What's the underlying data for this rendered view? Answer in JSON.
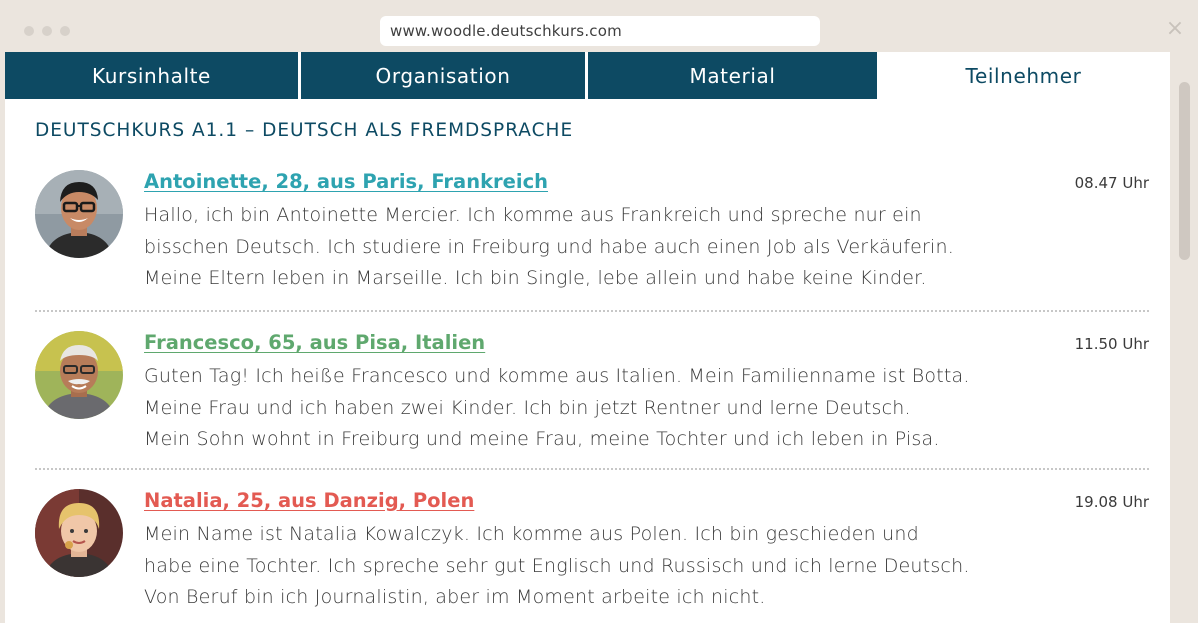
{
  "browser": {
    "url": "www.woodle.deutschkurs.com",
    "close_symbol": "×"
  },
  "tabs": [
    {
      "label": "Kursinhalte",
      "active": false
    },
    {
      "label": "Organisation",
      "active": false
    },
    {
      "label": "Material",
      "active": false
    },
    {
      "label": "Teilnehmer",
      "active": true
    }
  ],
  "course_title": "DEUTSCHKURS A1.1 – DEUTSCH ALS FREMDSPRACHE",
  "colors": {
    "tab_bg": "#0d4a63",
    "post1_name": "#2ea3b0",
    "post2_name": "#5fa86e",
    "post3_name": "#e35a52"
  },
  "posts": [
    {
      "name": "Antoinette, 28, aus Paris, Frankreich",
      "time": "08.47 Uhr",
      "lines": [
        "Hallo, ich bin Antoinette Mercier. Ich komme aus Frankreich und spreche nur ein",
        "bisschen Deutsch. Ich studiere in Freiburg und habe auch einen Job als Verkäuferin.",
        "Meine Eltern leben in Marseille. Ich bin Single, lebe allein und habe keine Kinder."
      ]
    },
    {
      "name": "Francesco, 65, aus Pisa, Italien",
      "time": "11.50 Uhr",
      "lines": [
        "Guten Tag! Ich heiße Francesco und komme aus Italien. Mein Familienname ist Botta.",
        "Meine Frau und ich haben zwei Kinder. Ich bin jetzt Rentner und lerne Deutsch.",
        "Mein Sohn wohnt in Freiburg und meine Frau, meine Tochter und ich leben in Pisa."
      ]
    },
    {
      "name": "Natalia, 25, aus Danzig, Polen",
      "time": "19.08 Uhr",
      "lines": [
        "Mein Name ist Natalia Kowalczyk. Ich komme aus Polen. Ich bin geschieden und",
        "habe eine Tochter. Ich spreche sehr gut Englisch und Russisch und ich lerne Deutsch.",
        "Von Beruf bin ich Journalistin, aber im Moment arbeite ich nicht."
      ]
    }
  ]
}
